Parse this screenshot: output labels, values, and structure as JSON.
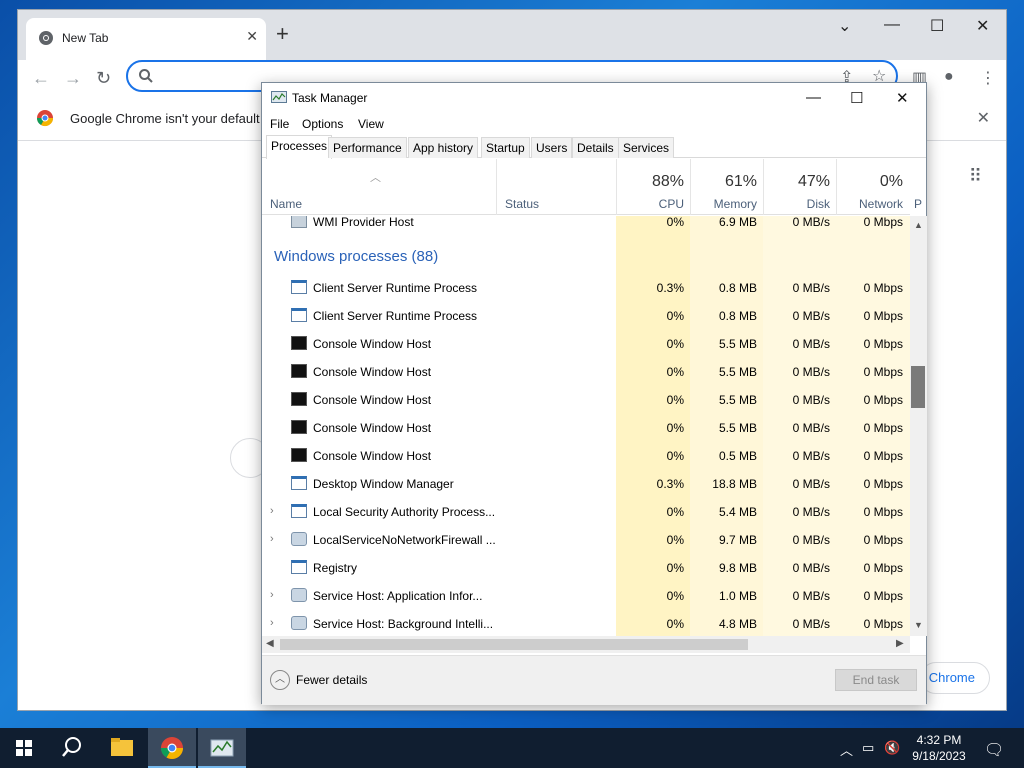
{
  "chrome": {
    "tab_title": "New Tab",
    "omnibox_placeholder": "",
    "infobar_text": "Google Chrome isn't your default",
    "set_default_label": "Chrome"
  },
  "task_manager": {
    "title": "Task Manager",
    "menu": [
      "File",
      "Options",
      "View"
    ],
    "tabs": [
      "Processes",
      "Performance",
      "App history",
      "Startup",
      "Users",
      "Details",
      "Services"
    ],
    "active_tab": "Processes",
    "columns": {
      "name": "Name",
      "status": "Status",
      "cpu": {
        "pct": "88%",
        "label": "CPU"
      },
      "memory": {
        "pct": "61%",
        "label": "Memory"
      },
      "disk": {
        "pct": "47%",
        "label": "Disk"
      },
      "network": {
        "pct": "0%",
        "label": "Network"
      },
      "more": "P"
    },
    "partial_row": {
      "name": "WMI Provider Host",
      "cpu": "0%",
      "memory": "6.9 MB",
      "disk": "0 MB/s",
      "network": "0 Mbps"
    },
    "group_label": "Windows processes (88)",
    "rows": [
      {
        "name": "Client Server Runtime Process",
        "icon": "window-icon",
        "expand": false,
        "cpu": "0.3%",
        "memory": "0.8 MB",
        "disk": "0 MB/s",
        "network": "0 Mbps"
      },
      {
        "name": "Client Server Runtime Process",
        "icon": "window-icon",
        "expand": false,
        "cpu": "0%",
        "memory": "0.8 MB",
        "disk": "0 MB/s",
        "network": "0 Mbps"
      },
      {
        "name": "Console Window Host",
        "icon": "console-icon",
        "expand": false,
        "cpu": "0%",
        "memory": "5.5 MB",
        "disk": "0 MB/s",
        "network": "0 Mbps"
      },
      {
        "name": "Console Window Host",
        "icon": "console-icon",
        "expand": false,
        "cpu": "0%",
        "memory": "5.5 MB",
        "disk": "0 MB/s",
        "network": "0 Mbps"
      },
      {
        "name": "Console Window Host",
        "icon": "console-icon",
        "expand": false,
        "cpu": "0%",
        "memory": "5.5 MB",
        "disk": "0 MB/s",
        "network": "0 Mbps"
      },
      {
        "name": "Console Window Host",
        "icon": "console-icon",
        "expand": false,
        "cpu": "0%",
        "memory": "5.5 MB",
        "disk": "0 MB/s",
        "network": "0 Mbps"
      },
      {
        "name": "Console Window Host",
        "icon": "console-icon",
        "expand": false,
        "cpu": "0%",
        "memory": "0.5 MB",
        "disk": "0 MB/s",
        "network": "0 Mbps"
      },
      {
        "name": "Desktop Window Manager",
        "icon": "window-icon",
        "expand": false,
        "cpu": "0.3%",
        "memory": "18.8 MB",
        "disk": "0 MB/s",
        "network": "0 Mbps"
      },
      {
        "name": "Local Security Authority Process...",
        "icon": "window-icon",
        "expand": true,
        "cpu": "0%",
        "memory": "5.4 MB",
        "disk": "0 MB/s",
        "network": "0 Mbps"
      },
      {
        "name": "LocalServiceNoNetworkFirewall ...",
        "icon": "gear-icon",
        "expand": true,
        "cpu": "0%",
        "memory": "9.7 MB",
        "disk": "0 MB/s",
        "network": "0 Mbps"
      },
      {
        "name": "Registry",
        "icon": "window-icon",
        "expand": false,
        "cpu": "0%",
        "memory": "9.8 MB",
        "disk": "0 MB/s",
        "network": "0 Mbps"
      },
      {
        "name": "Service Host: Application Infor...",
        "icon": "gear-icon",
        "expand": true,
        "cpu": "0%",
        "memory": "1.0 MB",
        "disk": "0 MB/s",
        "network": "0 Mbps"
      },
      {
        "name": "Service Host: Background Intelli...",
        "icon": "gear-icon",
        "expand": true,
        "cpu": "0%",
        "memory": "4.8 MB",
        "disk": "0 MB/s",
        "network": "0 Mbps"
      }
    ],
    "fewer_details": "Fewer details",
    "end_task": "End task"
  },
  "taskbar": {
    "time": "4:32 PM",
    "date": "9/18/2023"
  },
  "colors": {
    "accent": "#1a73e8",
    "cpu_highlight": "#fff4c4",
    "group_text": "#2a62b8"
  }
}
